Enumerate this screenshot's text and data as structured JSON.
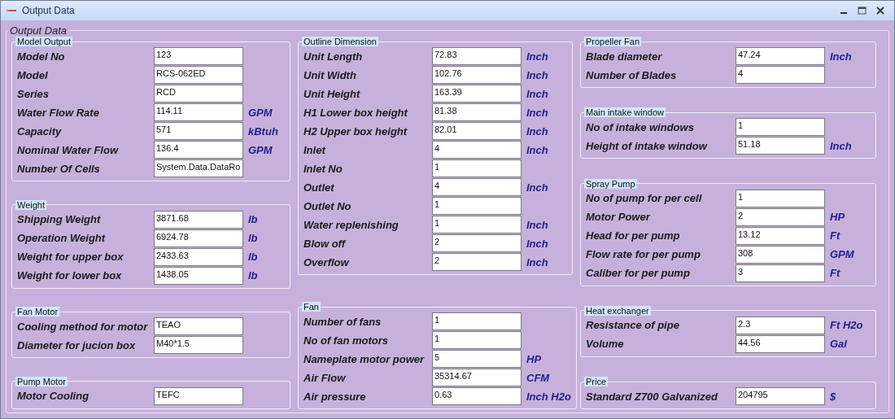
{
  "window": {
    "title": "Output Data"
  },
  "frame": {
    "title": "Output Data"
  },
  "columns": [
    [
      {
        "title": "Model Output",
        "rows": [
          {
            "label": "Model No",
            "value": "123"
          },
          {
            "label": "Model",
            "value": "RCS-062ED"
          },
          {
            "label": "Series",
            "value": "RCD"
          },
          {
            "label": "Water Flow Rate",
            "value": "114.11",
            "unit": "GPM"
          },
          {
            "label": "Capacity",
            "value": "571",
            "unit": "kBtuh"
          },
          {
            "label": "Nominal Water Flow",
            "value": "136.4",
            "unit": "GPM"
          },
          {
            "label": "Number Of Cells",
            "value": "System.Data.DataRo"
          }
        ]
      },
      {
        "title": "Weight",
        "rows": [
          {
            "label": "Shipping Weight",
            "value": "3871.68",
            "unit": "lb"
          },
          {
            "label": "Operation Weight",
            "value": "6924.78",
            "unit": "lb"
          },
          {
            "label": "Weight for upper box",
            "value": "2433.63",
            "unit": "lb"
          },
          {
            "label": "Weight for lower box",
            "value": "1438.05",
            "unit": "lb"
          }
        ]
      },
      {
        "title": "Fan Motor",
        "rows": [
          {
            "label": "Cooling method for motor",
            "value": "TEAO"
          },
          {
            "label": "Diameter for jucion box",
            "value": "M40*1.5"
          }
        ]
      },
      {
        "title": "Pump Motor",
        "rows": [
          {
            "label": "Motor Cooling",
            "value": "TEFC"
          }
        ]
      }
    ],
    [
      {
        "title": "Outline Dimension",
        "rows": [
          {
            "label": "Unit Length",
            "value": "72.83",
            "unit": "Inch"
          },
          {
            "label": "Unit Width",
            "value": "102.76",
            "unit": "Inch"
          },
          {
            "label": "Unit Height",
            "value": "163.39",
            "unit": "Inch"
          },
          {
            "label": "H1 Lower  box height",
            "value": "81.38",
            "unit": "Inch"
          },
          {
            "label": "H2 Upper box height",
            "value": "82.01",
            "unit": "Inch"
          },
          {
            "label": "Inlet",
            "value": "4",
            "unit": "Inch"
          },
          {
            "label": "Inlet No",
            "value": "1"
          },
          {
            "label": "Outlet",
            "value": "4",
            "unit": "Inch"
          },
          {
            "label": "Outlet No",
            "value": "1"
          },
          {
            "label": "Water replenishing",
            "value": "1",
            "unit": "Inch"
          },
          {
            "label": "Blow off",
            "value": "2",
            "unit": "Inch"
          },
          {
            "label": "Overflow",
            "value": "2",
            "unit": "Inch"
          }
        ]
      },
      {
        "title": "Fan",
        "rows": [
          {
            "label": "Number of fans",
            "value": "1"
          },
          {
            "label": "No of fan motors",
            "value": "1"
          },
          {
            "label": "Nameplate motor power",
            "value": "5",
            "unit": "HP"
          },
          {
            "label": "Air Flow",
            "value": "35314.67",
            "unit": "CFM"
          },
          {
            "label": "Air pressure",
            "value": "0.63",
            "unit": "Inch H2o"
          }
        ]
      }
    ],
    [
      {
        "title": "Propeller Fan",
        "rows": [
          {
            "label": "Blade diameter",
            "value": "47.24",
            "unit": "Inch"
          },
          {
            "label": "Number of Blades",
            "value": "4"
          }
        ]
      },
      {
        "title": "Main intake window",
        "rows": [
          {
            "label": "No of intake windows",
            "value": "1"
          },
          {
            "label": "Height of intake window",
            "value": "51.18",
            "unit": "Inch"
          }
        ]
      },
      {
        "title": "Spray Pump",
        "rows": [
          {
            "label": "No of pump for per cell",
            "value": "1"
          },
          {
            "label": "Motor Power",
            "value": "2",
            "unit": "HP"
          },
          {
            "label": "Head for per pump",
            "value": "13.12",
            "unit": "Ft"
          },
          {
            "label": "Flow rate for per pump",
            "value": "308",
            "unit": "GPM"
          },
          {
            "label": "Caliber for per pump",
            "value": "3",
            "unit": "Ft"
          }
        ]
      },
      {
        "title": "Heat exchanger",
        "rows": [
          {
            "label": "Resistance of pipe",
            "value": "2.3",
            "unit": "Ft H2o"
          },
          {
            "label": "Volume",
            "value": "44.56",
            "unit": "Gal"
          }
        ]
      },
      {
        "title": "Price",
        "rows": [
          {
            "label": "Standard Z700 Galvanized",
            "value": "204795",
            "unit": "$"
          }
        ]
      }
    ]
  ]
}
